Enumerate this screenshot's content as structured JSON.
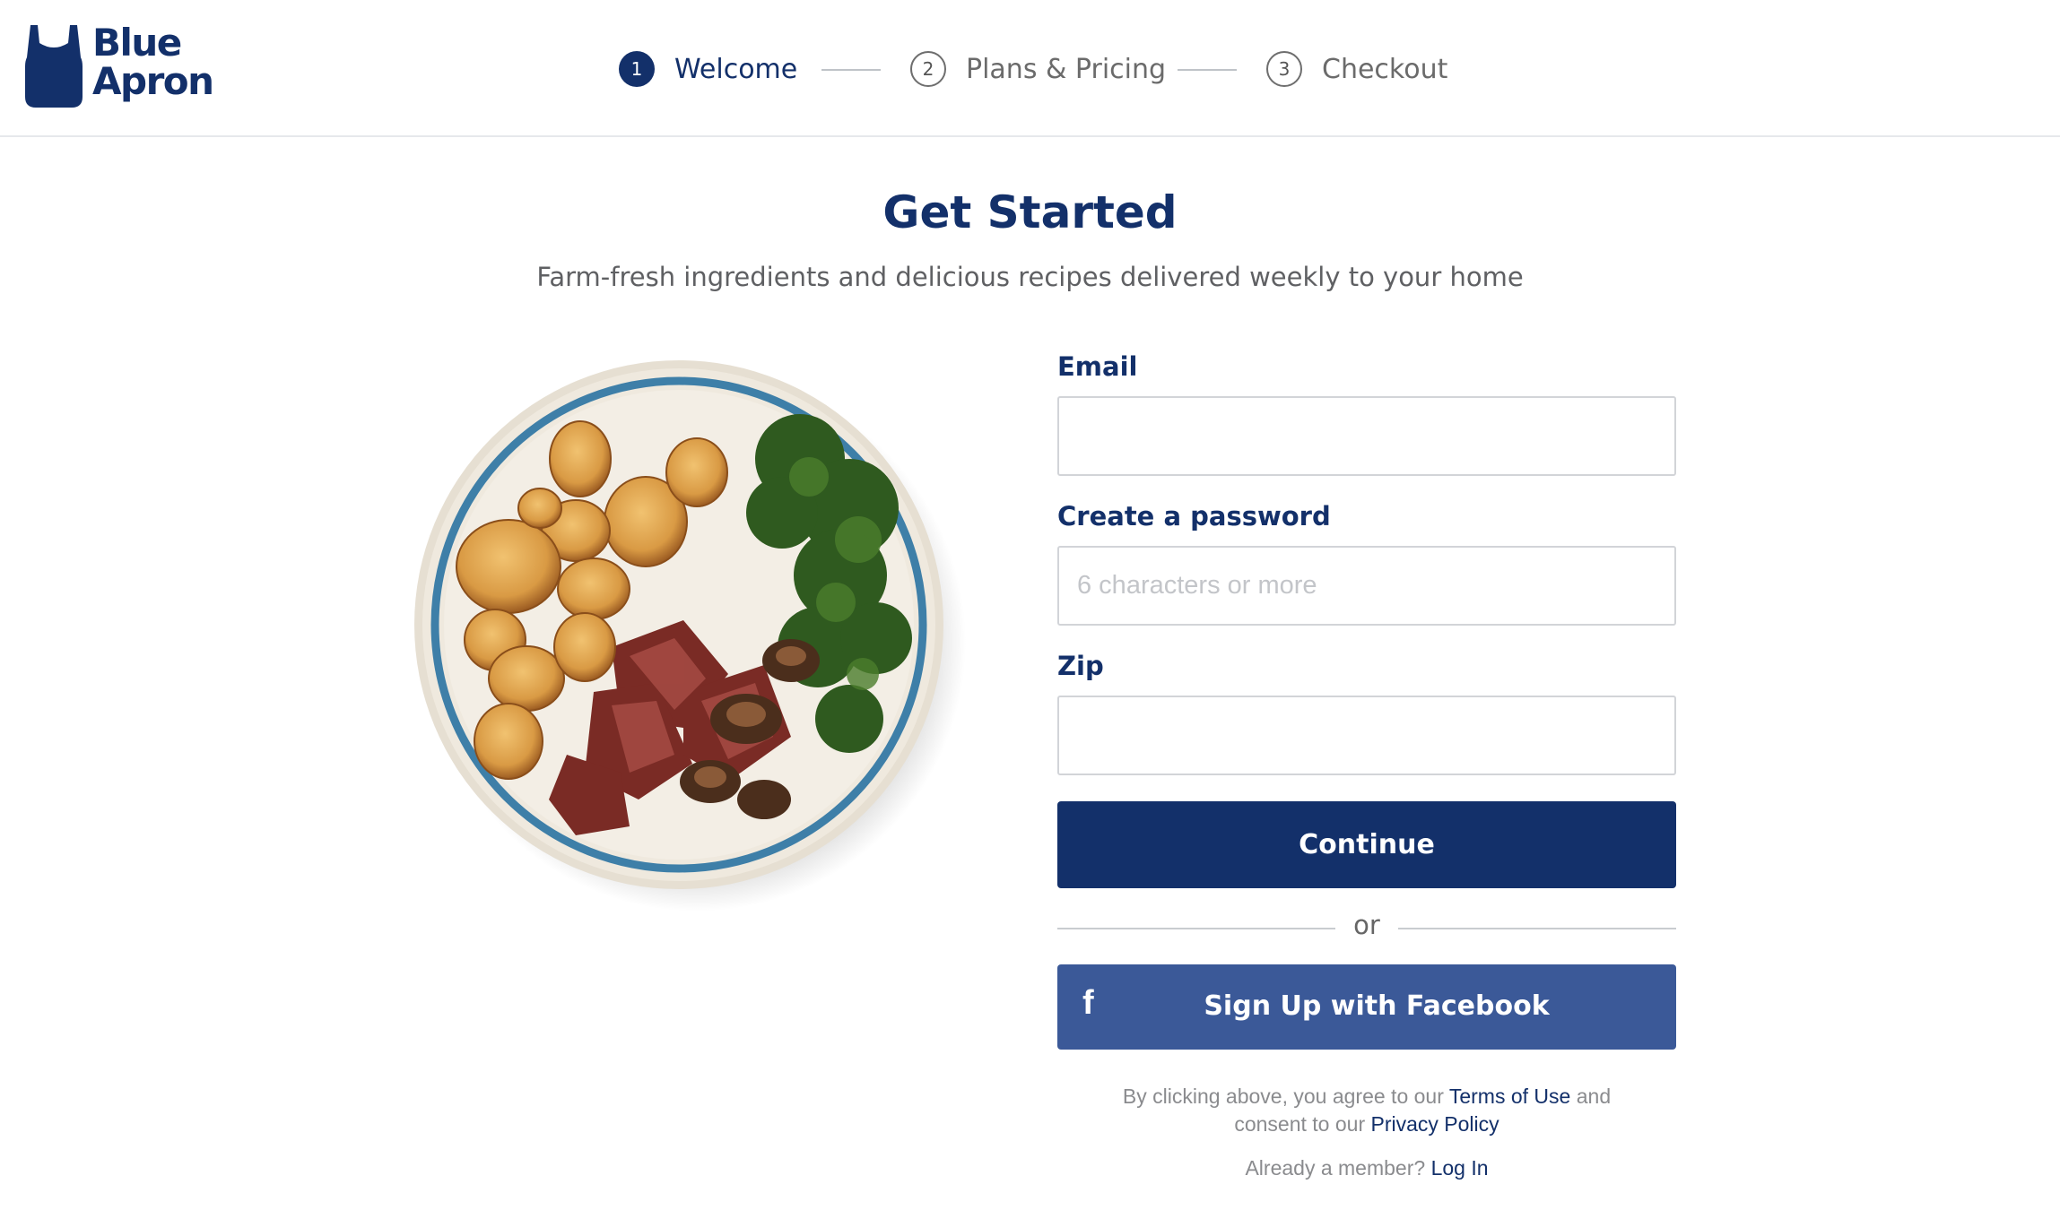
{
  "brand": {
    "line1": "Blue",
    "line2": "Apron",
    "color": "#13306a"
  },
  "steps": [
    {
      "number": "1",
      "label": "Welcome",
      "state": "active"
    },
    {
      "number": "2",
      "label": "Plans & Pricing",
      "state": "inactive"
    },
    {
      "number": "3",
      "label": "Checkout",
      "state": "inactive"
    }
  ],
  "hero": {
    "title": "Get Started",
    "subtitle": "Farm-fresh ingredients and delicious recipes delivered weekly to your home"
  },
  "form": {
    "email_label": "Email",
    "email_value": "",
    "password_label": "Create a password",
    "password_placeholder": "6 characters or more",
    "zip_label": "Zip",
    "zip_value": "",
    "continue_label": "Continue",
    "or_text": "or",
    "facebook_label": "Sign Up with Facebook",
    "facebook_icon": "facebook-f-icon"
  },
  "legal": {
    "prefix": "By clicking above, you agree to our ",
    "terms_link": "Terms of Use",
    "middle": " and",
    "consent": "consent to our ",
    "privacy_link": "Privacy Policy"
  },
  "member": {
    "prefix": "Already a member? ",
    "login_link": "Log In"
  },
  "colors": {
    "primary": "#13306a",
    "facebook": "#3b5998",
    "text_muted": "#8a8b8e"
  }
}
